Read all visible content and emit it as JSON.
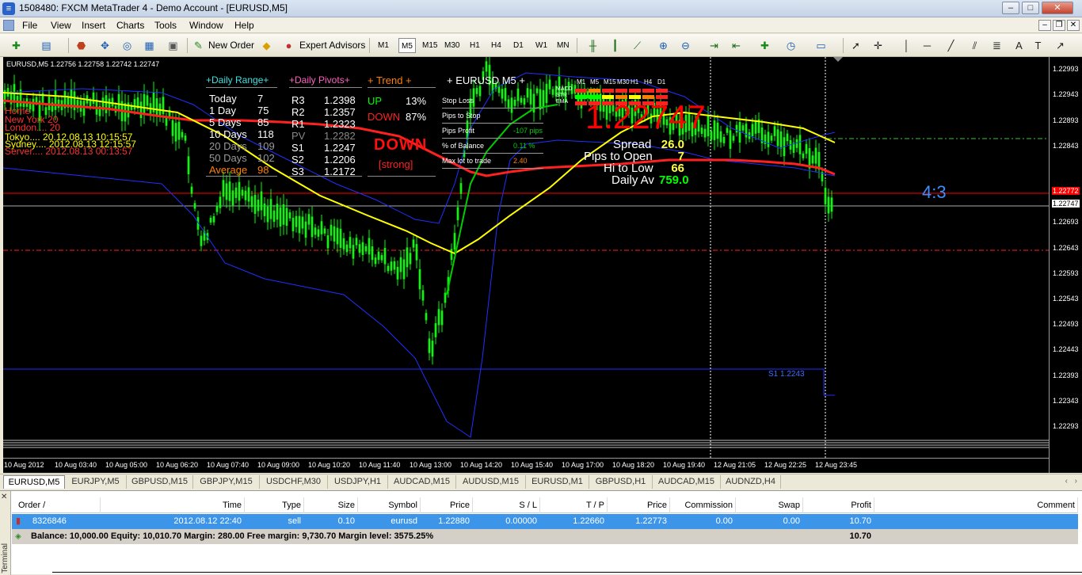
{
  "window": {
    "title": "1508480: FXCM MetaTrader 4 - Demo Account - [EURUSD,M5]"
  },
  "menu": [
    "File",
    "View",
    "Insert",
    "Charts",
    "Tools",
    "Window",
    "Help"
  ],
  "toolbar": {
    "new_order": "New Order",
    "expert_advisors": "Expert Advisors",
    "timeframes": [
      "M1",
      "M5",
      "M15",
      "M30",
      "H1",
      "H4",
      "D1",
      "W1",
      "MN"
    ],
    "active_timeframe": "M5"
  },
  "chart": {
    "header": "EURUSD,M5  1.22756 1.22758 1.22742 1.22747",
    "price_ticks": [
      "1.22993",
      "1.22943",
      "1.22893",
      "1.22843",
      "1.22772",
      "1.22747",
      "1.22693",
      "1.22643",
      "1.22593",
      "1.22543",
      "1.22493",
      "1.22443",
      "1.22393",
      "1.22343",
      "1.22293"
    ],
    "time_ticks": [
      "10 Aug 2012",
      "10 Aug 03:40",
      "10 Aug 05:00",
      "10 Aug 06:20",
      "10 Aug 07:40",
      "10 Aug 09:00",
      "10 Aug 10:20",
      "10 Aug 11:40",
      "10 Aug 13:00",
      "10 Aug 14:20",
      "10 Aug 15:40",
      "10 Aug 17:00",
      "10 Aug 18:20",
      "10 Aug 19:40",
      "12 Aug 21:05",
      "12 Aug 22:25",
      "12 Aug 23:45"
    ],
    "clocks": [
      "Home",
      "New York",
      "London",
      "Tokyo",
      "Sydney",
      "Server"
    ],
    "clock_values": [
      "",
      "20",
      "20",
      "20.12.08.13 10:15:57",
      "2012.08.13 12:15:57",
      "2012.08.13 00:13:57"
    ],
    "daily_range": {
      "title": "+Daily Range+",
      "rows": [
        [
          "Today",
          "7"
        ],
        [
          "1 Day",
          "75"
        ],
        [
          "5 Days",
          "85"
        ],
        [
          "10 Days",
          "118"
        ],
        [
          "20 Days",
          "109"
        ],
        [
          "50 Days",
          "102"
        ],
        [
          "Average",
          "98"
        ]
      ]
    },
    "daily_pivots": {
      "title": "+Daily Pivots+",
      "rows": [
        [
          "R3",
          "1.2398"
        ],
        [
          "R2",
          "1.2357"
        ],
        [
          "R1",
          "1.2323"
        ],
        [
          "PV",
          "1.2282"
        ],
        [
          "S1",
          "1.2247"
        ],
        [
          "S2",
          "1.2206"
        ],
        [
          "S3",
          "1.2172"
        ]
      ]
    },
    "trend": {
      "title": "+ Trend +",
      "up_label": "UP",
      "up_value": "13%",
      "down_label": "DOWN",
      "down_value": "87%",
      "signal": "DOWN",
      "strength": "[strong]"
    },
    "trade_panel": {
      "title": "+ EURUSD M5 +",
      "rows": [
        [
          "Stop Loss",
          ""
        ],
        [
          "Pips to Stop",
          ""
        ],
        [
          "Pips Profit",
          "-107 pips"
        ],
        [
          "% of Balance",
          "0.11 %"
        ],
        [
          "Max lot to trade",
          "2.40"
        ]
      ]
    },
    "signal_grid": {
      "cols": [
        "M1",
        "M5",
        "M15",
        "M30",
        "H1",
        "H4",
        "D1"
      ],
      "rows": [
        "MACD",
        "STR",
        "EMA"
      ]
    },
    "big_price": "1.22747",
    "stats": [
      [
        "Spread",
        "26.0"
      ],
      [
        "Pips to Open",
        "7"
      ],
      [
        "Hi to Low",
        "66"
      ],
      [
        "Daily Av",
        "759.0"
      ]
    ],
    "ratio": "4:3",
    "s1_label": "S1 1.2243",
    "price_scale": {
      "min": 1.22268,
      "max": 1.23018
    },
    "colors": {
      "bull": "#00ff00",
      "ma_red": "#ff2020",
      "ma_yellow": "#ffff00",
      "band": "#2030ff",
      "line_red": "#ff0000"
    }
  },
  "symbol_tabs": [
    "EURUSD,M5",
    "EURJPY,M5",
    "GBPUSD,M15",
    "GBPJPY,M15",
    "USDCHF,M30",
    "USDJPY,H1",
    "AUDCAD,M15",
    "AUDUSD,M15",
    "EURUSD,M1",
    "GBPUSD,H1",
    "AUDCAD,M15",
    "AUDNZD,H4"
  ],
  "terminal": {
    "side_label": "Terminal",
    "columns": [
      "Order",
      "Time",
      "Type",
      "Size",
      "Symbol",
      "Price",
      "S / L",
      "T / P",
      "Price",
      "Commission",
      "Swap",
      "Profit",
      "Comment"
    ],
    "orders": [
      [
        "8326846",
        "2012.08.12 22:40",
        "sell",
        "0.10",
        "eurusd",
        "1.22880",
        "0.00000",
        "1.22660",
        "1.22773",
        "0.00",
        "0.00",
        "10.70",
        ""
      ]
    ],
    "balance_line": "Balance: 10,000.00  Equity: 10,010.70  Margin: 280.00  Free margin: 9,730.70  Margin level: 3575.25%",
    "balance_profit": "10.70"
  }
}
